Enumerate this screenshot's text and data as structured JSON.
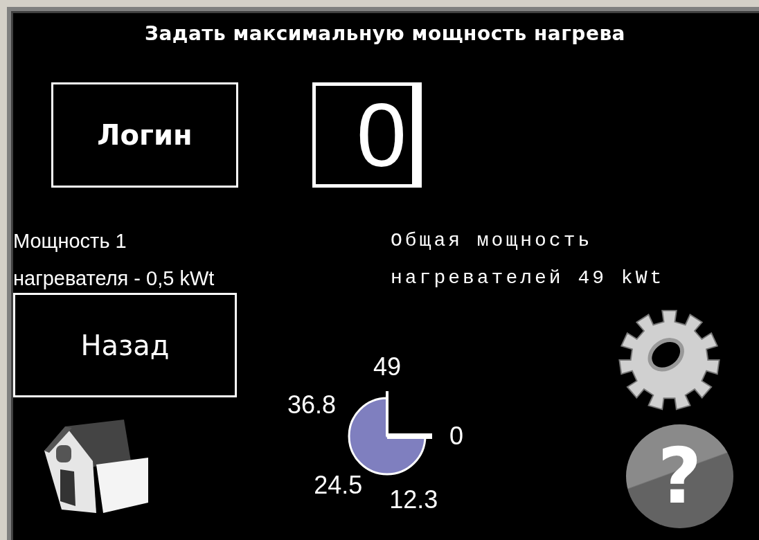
{
  "title": "Задать максимальную мощность нагрева",
  "login_button": {
    "label": "Логин"
  },
  "value_display": {
    "value": "0"
  },
  "heater_power": {
    "lines": [
      "Мощность 1",
      "нагревателя - 0,5 kWt"
    ]
  },
  "total_power": {
    "lines": [
      "Общая мощность",
      "нагревателей 49 kWt"
    ]
  },
  "back_button": {
    "label": "Назад"
  },
  "gauge": {
    "scale": [
      "0",
      "12.3",
      "24.5",
      "36.8",
      "49"
    ]
  },
  "help_button": {
    "symbol": "?"
  }
}
